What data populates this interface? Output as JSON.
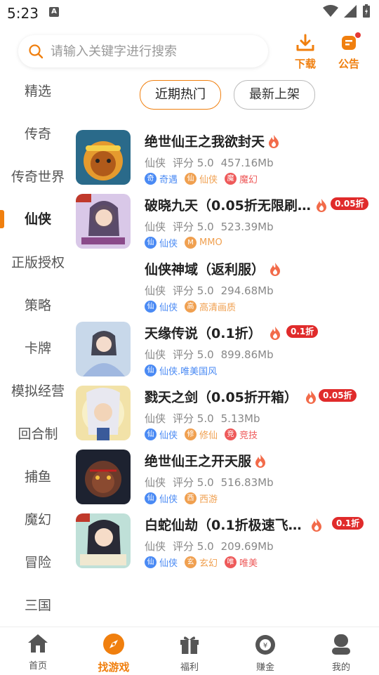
{
  "status": {
    "time": "5:23",
    "a_icon": "A"
  },
  "search": {
    "placeholder": "请输入关键字进行搜索"
  },
  "actions": {
    "download": "下载",
    "notice": "公告"
  },
  "sidebar": [
    "精选",
    "传奇",
    "传奇世界",
    "仙侠",
    "正版授权",
    "策略",
    "卡牌",
    "模拟经营",
    "回合制",
    "捕鱼",
    "魔幻",
    "冒险",
    "三国"
  ],
  "sidebar_active": "仙侠",
  "tabs": [
    {
      "label": "近期热门",
      "active": true
    },
    {
      "label": "最新上架",
      "active": false
    }
  ],
  "games": [
    {
      "title": "绝世仙王之我欲封天",
      "fire": true,
      "discount": "",
      "category": "仙侠",
      "rating": "评分 5.0",
      "size": "457.16Mb",
      "tags": [
        {
          "icon": "奇",
          "label": "奇遇",
          "color": "#4a8af4"
        },
        {
          "icon": "仙",
          "label": "仙侠",
          "color": "#f0a050"
        },
        {
          "icon": "魔",
          "label": "魔幻",
          "color": "#ee5a5a"
        }
      ]
    },
    {
      "title": "破晓九天（0.05折无限刷…",
      "fire": true,
      "discount": "0.05折",
      "category": "仙侠",
      "rating": "评分 5.0",
      "size": "523.39Mb",
      "tags": [
        {
          "icon": "仙",
          "label": "仙侠",
          "color": "#4a8af4"
        },
        {
          "icon": "M",
          "label": "MMO",
          "color": "#f0a050"
        }
      ]
    },
    {
      "title": "仙侠神域（返利服）",
      "fire": true,
      "discount": "",
      "category": "仙侠",
      "rating": "评分 5.0",
      "size": "294.68Mb",
      "tags": [
        {
          "icon": "仙",
          "label": "仙侠",
          "color": "#4a8af4"
        },
        {
          "icon": "高",
          "label": "高清画质",
          "color": "#f0a050"
        }
      ]
    },
    {
      "title": "天缘传说（0.1折）",
      "fire": true,
      "discount": "0.1折",
      "category": "仙侠",
      "rating": "评分 5.0",
      "size": "899.86Mb",
      "tags": [
        {
          "icon": "仙",
          "label": "仙侠.唯美国风",
          "color": "#4a8af4"
        }
      ]
    },
    {
      "title": "戮天之剑（0.05折开箱）",
      "fire": true,
      "discount": "0.05折",
      "category": "仙侠",
      "rating": "评分 5.0",
      "size": "5.13Mb",
      "tags": [
        {
          "icon": "仙",
          "label": "仙侠",
          "color": "#4a8af4"
        },
        {
          "icon": "修",
          "label": "修仙",
          "color": "#f0a050"
        },
        {
          "icon": "竞",
          "label": "竞技",
          "color": "#ee5a5a"
        }
      ]
    },
    {
      "title": "绝世仙王之开天服",
      "fire": true,
      "discount": "",
      "category": "仙侠",
      "rating": "评分 5.0",
      "size": "516.83Mb",
      "tags": [
        {
          "icon": "仙",
          "label": "仙侠",
          "color": "#4a8af4"
        },
        {
          "icon": "西",
          "label": "西游",
          "color": "#f0a050"
        }
      ]
    },
    {
      "title": "白蛇仙劫（0.1折极速飞…",
      "fire": true,
      "discount": "0.1折",
      "category": "仙侠",
      "rating": "评分 5.0",
      "size": "209.69Mb",
      "tags": [
        {
          "icon": "仙",
          "label": "仙侠",
          "color": "#4a8af4"
        },
        {
          "icon": "玄",
          "label": "玄幻",
          "color": "#f0a050"
        },
        {
          "icon": "唯",
          "label": "唯美",
          "color": "#ee5a5a"
        }
      ]
    }
  ],
  "nav": [
    {
      "label": "首页",
      "icon": "home-icon",
      "active": false
    },
    {
      "label": "找游戏",
      "icon": "compass-icon",
      "active": true
    },
    {
      "label": "福利",
      "icon": "gift-icon",
      "active": false
    },
    {
      "label": "赚金",
      "icon": "coin-bag-icon",
      "active": false
    },
    {
      "label": "我的",
      "icon": "user-icon",
      "active": false
    }
  ],
  "colors": {
    "accent": "#f07f0e",
    "discount": "#e02b2b"
  }
}
